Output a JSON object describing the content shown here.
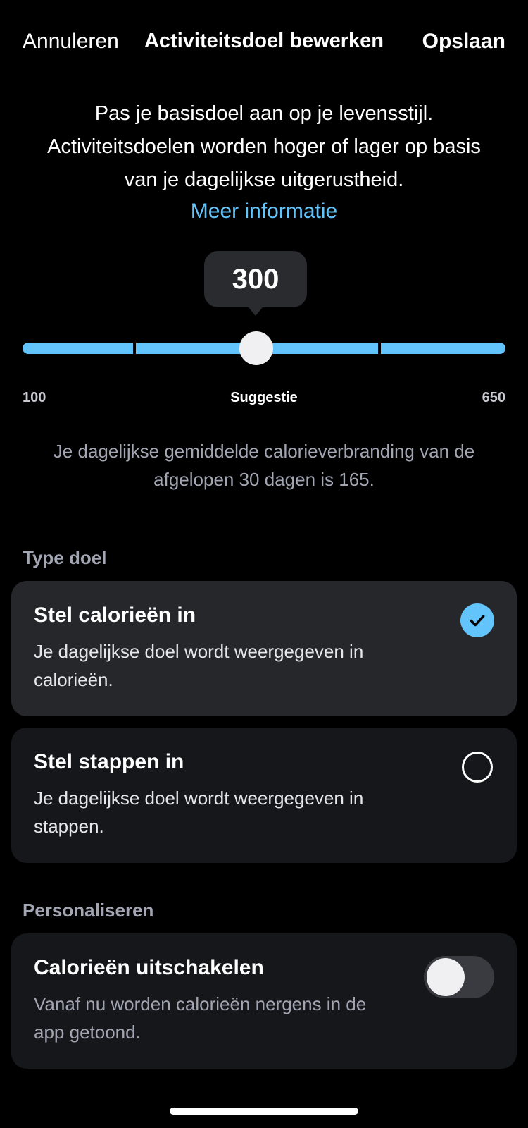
{
  "header": {
    "cancel_label": "Annuleren",
    "title": "Activiteitsdoel bewerken",
    "save_label": "Opslaan"
  },
  "intro": {
    "text": "Pas je basisdoel aan op je levensstijl. Activiteitsdoelen worden hoger of lager op basis van je dagelijkse uitgerustheid.",
    "more_info_label": "Meer informatie"
  },
  "slider": {
    "value": "300",
    "min_label": "100",
    "mid_label": "Suggestie",
    "max_label": "650"
  },
  "average_text": "Je dagelijkse gemiddelde calorieverbranding van de afgelopen 30 dagen is 165.",
  "goal_type": {
    "section_label": "Type doel",
    "options": [
      {
        "title": "Stel calorieën in",
        "description": " Je dagelijkse doel wordt weergegeven in calorieën.",
        "selected": true
      },
      {
        "title": "Stel stappen in",
        "description": "Je dagelijkse doel wordt weergegeven in stappen.",
        "selected": false
      }
    ]
  },
  "personalize": {
    "section_label": "Personaliseren",
    "toggle_title": "Calorieën uitschakelen",
    "toggle_description": "Vanaf nu worden calorieën nergens in de app getoond.",
    "toggle_on": false
  },
  "colors": {
    "accent": "#63c3fb",
    "background": "#000000",
    "card_selected": "#26272b",
    "card": "#16171a"
  },
  "icons": {
    "selected_option": "checkmark-icon"
  }
}
